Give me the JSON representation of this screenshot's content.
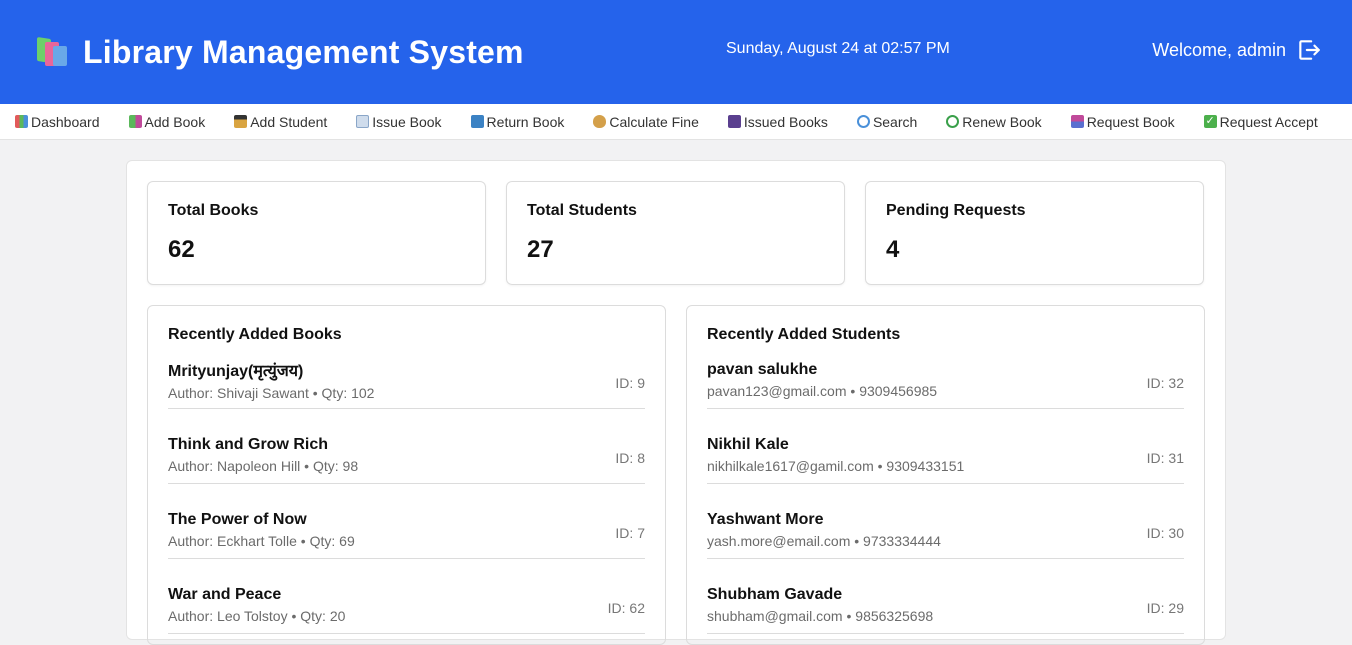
{
  "header": {
    "title": "Library Management System",
    "datetime": "Sunday, August 24 at 02:57 PM",
    "welcome": "Welcome, admin"
  },
  "nav": [
    {
      "label": "Dashboard",
      "icon": "bar-chart-icon",
      "color": "#7aa7d9"
    },
    {
      "label": "Add Book",
      "icon": "books-icon",
      "color": "#5bb85b"
    },
    {
      "label": "Add Student",
      "icon": "student-icon",
      "color": "#d9a441"
    },
    {
      "label": "Issue Book",
      "icon": "open-book-icon",
      "color": "#9db7d6"
    },
    {
      "label": "Return Book",
      "icon": "return-icon",
      "color": "#3b82c4"
    },
    {
      "label": "Calculate Fine",
      "icon": "money-bag-icon",
      "color": "#d4a04a"
    },
    {
      "label": "Issued Books",
      "icon": "notebook-icon",
      "color": "#6b4ea0"
    },
    {
      "label": "Search",
      "icon": "search-icon",
      "color": "#4a90d9"
    },
    {
      "label": "Renew Book",
      "icon": "recycle-icon",
      "color": "#3aa04a"
    },
    {
      "label": "Request Book",
      "icon": "inbox-icon",
      "color": "#c04a9a"
    },
    {
      "label": "Request Accept",
      "icon": "check-icon",
      "color": "#4cb04c"
    }
  ],
  "stats": [
    {
      "label": "Total Books",
      "value": "62"
    },
    {
      "label": "Total Students",
      "value": "27"
    },
    {
      "label": "Pending Requests",
      "value": "4"
    }
  ],
  "books": {
    "title": "Recently Added Books",
    "items": [
      {
        "title": "Mrityunjay(मृत्युंजय)",
        "sub": "Author: Shivaji Sawant • Qty: 102",
        "id": "ID: 9"
      },
      {
        "title": "Think and Grow Rich",
        "sub": "Author: Napoleon Hill • Qty: 98",
        "id": "ID: 8"
      },
      {
        "title": "The Power of Now",
        "sub": "Author: Eckhart Tolle • Qty: 69",
        "id": "ID: 7"
      },
      {
        "title": "War and Peace",
        "sub": "Author: Leo Tolstoy • Qty: 20",
        "id": "ID: 62"
      }
    ]
  },
  "students": {
    "title": "Recently Added Students",
    "items": [
      {
        "title": "pavan salukhe",
        "sub": "pavan123@gmail.com • 9309456985",
        "id": "ID: 32"
      },
      {
        "title": "Nikhil Kale",
        "sub": "nikhilkale1617@gamil.com • 9309433151",
        "id": "ID: 31"
      },
      {
        "title": "Yashwant More",
        "sub": "yash.more@email.com • 9733334444",
        "id": "ID: 30"
      },
      {
        "title": "Shubham Gavade",
        "sub": "shubham@gmail.com • 9856325698",
        "id": "ID: 29"
      }
    ]
  }
}
